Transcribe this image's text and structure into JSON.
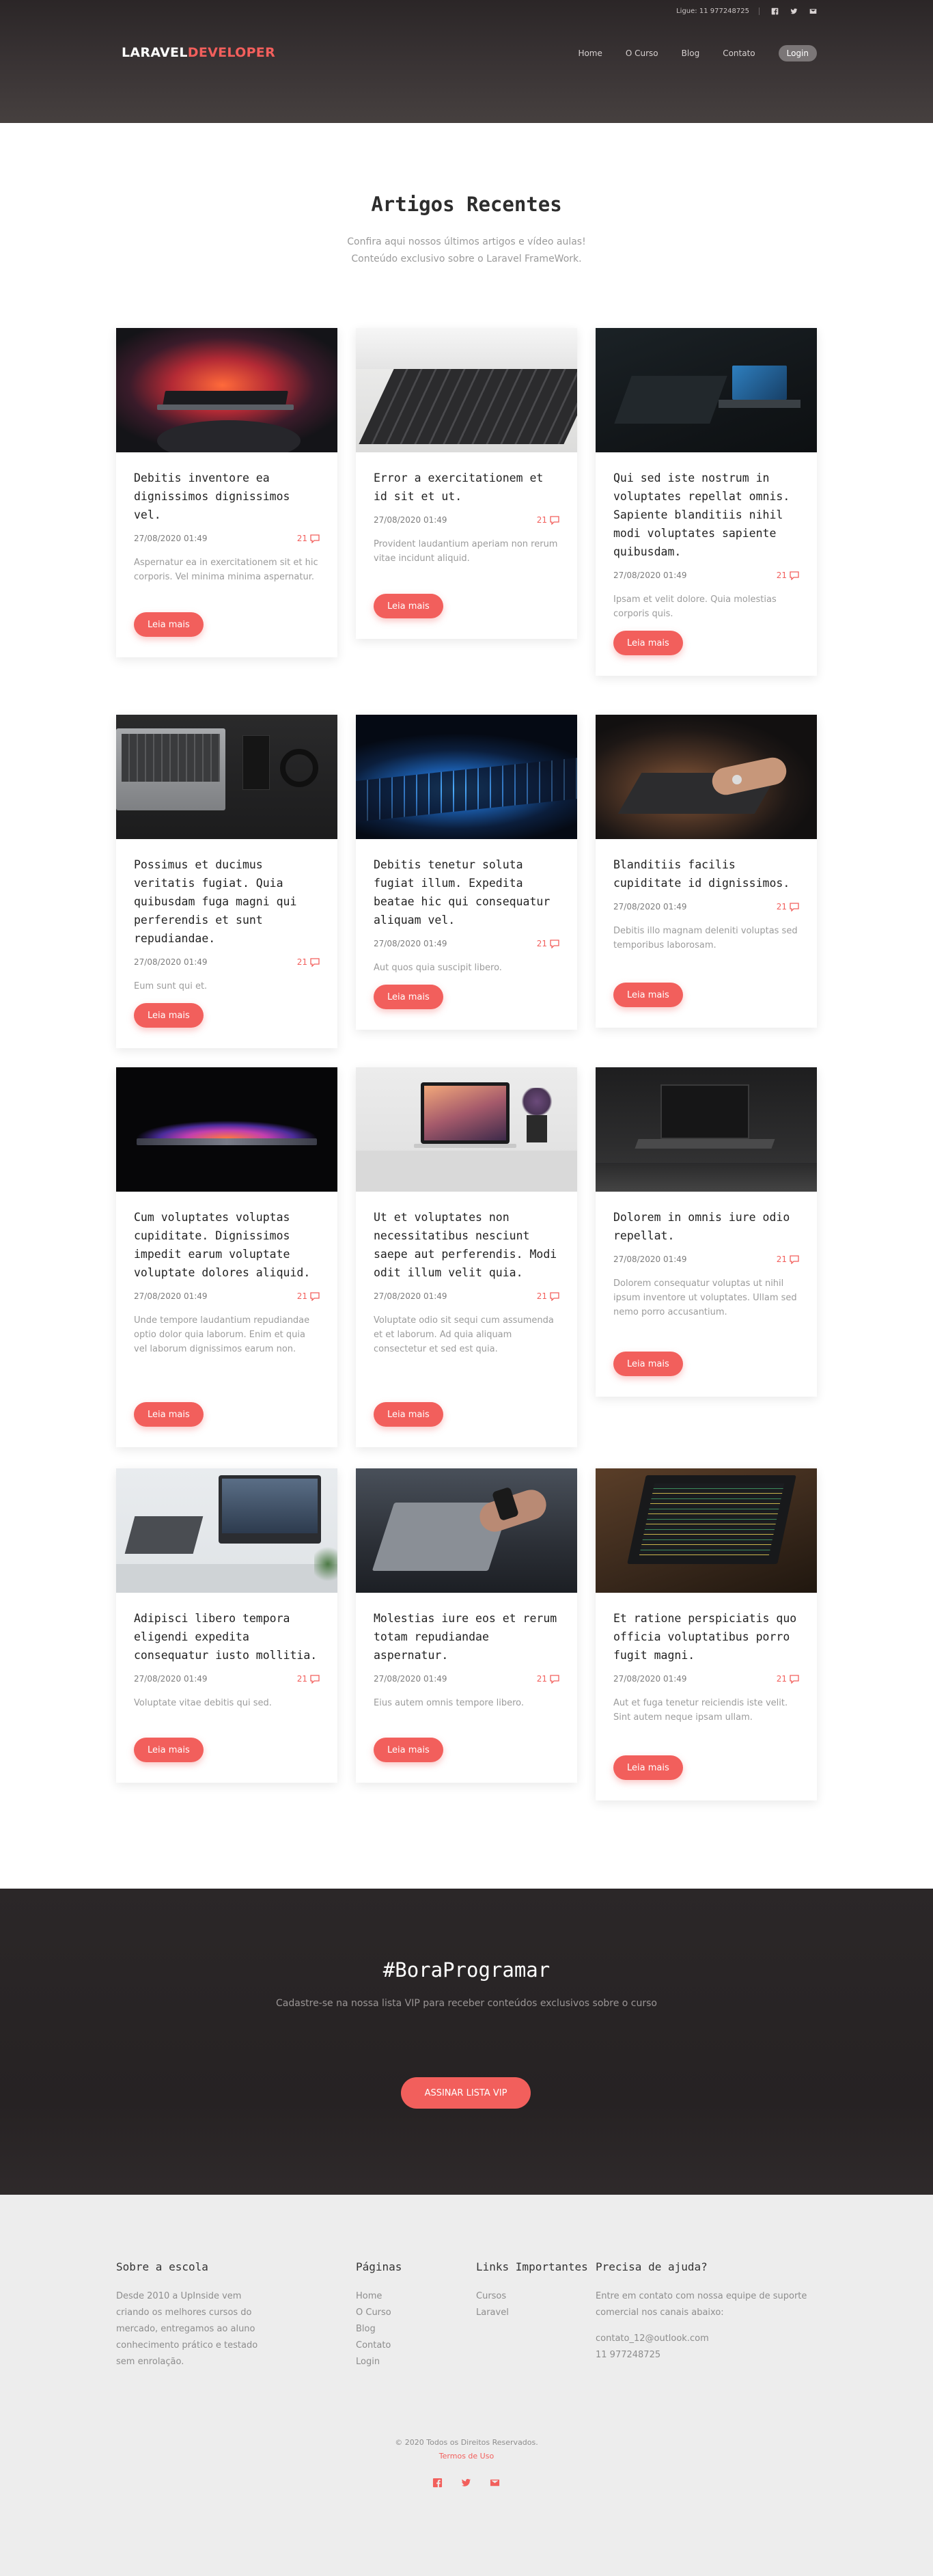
{
  "header": {
    "phone": "Ligue: 11 977248725",
    "brand_part1": "LARAVEL",
    "brand_part2": "DEVELOPER",
    "nav": [
      "Home",
      "O Curso",
      "Blog",
      "Contato",
      "Login"
    ]
  },
  "articles_section": {
    "title": "Artigos Recentes",
    "subtitle_line1": "Confira aqui nossos últimos artigos e vídeo aulas!",
    "subtitle_line2": "Conteúdo exclusivo sobre o Laravel FrameWork."
  },
  "cards": [
    {
      "image": "laptop-red-glow",
      "title": "Debitis inventore ea dignissimos dignissimos vel.",
      "date": "27/08/2020 01:49",
      "comments": "21",
      "excerpt": "Aspernatur ea in exercitationem sit et hic corporis. Vel minima minima aspernatur.",
      "button": "Leia mais"
    },
    {
      "image": "laptop-keyboard-closeup",
      "title": "Error a exercitationem et id sit et ut.",
      "date": "27/08/2020 01:49",
      "comments": "21",
      "excerpt": "Provident laudantium aperiam non rerum vitae incidunt aliquid.",
      "button": "Leia mais"
    },
    {
      "image": "dark-desk-laptop",
      "title": "Qui sed iste nostrum in voluptates repellat omnis. Sapiente blanditiis nihil modi voluptates sapiente quibusdam.",
      "date": "27/08/2020 01:49",
      "comments": "21",
      "excerpt": "Ipsam et velit dolore. Quia molestias corporis quis.",
      "button": "Leia mais"
    },
    {
      "image": "laptop-headphones-desk",
      "title": "Possimus et ducimus veritatis fugiat. Quia quibusdam fuga magni qui perferendis et sunt repudiandae.",
      "date": "27/08/2020 01:49",
      "comments": "21",
      "excerpt": "Eum sunt qui et.",
      "button": "Leia mais"
    },
    {
      "image": "blue-keyboard-glow",
      "title": "Debitis tenetur soluta fugiat illum. Expedita beatae hic qui consequatur aliquam vel.",
      "date": "27/08/2020 01:49",
      "comments": "21",
      "excerpt": "Aut quos quia suscipit libero.",
      "button": "Leia mais"
    },
    {
      "image": "hands-typing-laptop",
      "title": "Blanditiis facilis cupiditate id dignissimos.",
      "date": "27/08/2020 01:49",
      "comments": "21",
      "excerpt": "Debitis illo magnam deleniti voluptas sed temporibus laborosam.",
      "button": "Leia mais"
    },
    {
      "image": "laptop-colorful-glow",
      "title": "Cum voluptates voluptas cupiditate. Dignissimos impedit earum voluptate voluptate dolores aliquid.",
      "date": "27/08/2020 01:49",
      "comments": "21",
      "excerpt": "Unde tempore laudantium repudiandae optio dolor quia laborum. Enim et quia vel laborum dignissimos earum non.",
      "button": "Leia mais"
    },
    {
      "image": "macbook-on-desk-plant",
      "title": "Ut et voluptates non necessitatibus nesciunt saepe aut perferendis. Modi odit illum velit quia.",
      "date": "27/08/2020 01:49",
      "comments": "21",
      "excerpt": "Voluptate odio sit sequi cum assumenda et et laborum. Ad quia aliquam consectetur et sed est quia.",
      "button": "Leia mais"
    },
    {
      "image": "laptop-dark-street",
      "title": "Dolorem in omnis iure odio repellat.",
      "date": "27/08/2020 01:49",
      "comments": "21",
      "excerpt": "Dolorem consequatur voluptas ut nihil ipsum inventore ut voluptates. Ullam sed nemo porro accusantium.",
      "button": "Leia mais"
    },
    {
      "image": "imac-workspace",
      "title": "Adipisci libero tempora eligendi expedita consequatur iusto mollitia.",
      "date": "27/08/2020 01:49",
      "comments": "21",
      "excerpt": "Voluptate vitae debitis qui sed.",
      "button": "Leia mais"
    },
    {
      "image": "hand-on-laptop",
      "title": "Molestias iure eos et rerum totam repudiandae aspernatur.",
      "date": "27/08/2020 01:49",
      "comments": "21",
      "excerpt": "Eius autem omnis tempore libero.",
      "button": "Leia mais"
    },
    {
      "image": "laptop-code-wood",
      "title": "Et ratione perspiciatis quo officia voluptatibus porro fugit magni.",
      "date": "27/08/2020 01:49",
      "comments": "21",
      "excerpt": "Aut et fuga tenetur reiciendis iste velit. Sint autem neque ipsam ullam.",
      "button": "Leia mais"
    }
  ],
  "vip": {
    "title": "#BoraProgramar",
    "subtitle": "Cadastre-se na nossa lista VIP para receber conteúdos exclusivos sobre o curso",
    "button": "ASSINAR LISTA VIP"
  },
  "footer": {
    "about_title": "Sobre a escola",
    "about_lines": [
      "Desde 2010 a UpInside vem",
      "criando os melhores cursos do",
      "mercado, entregamos ao aluno",
      "conhecimento prático e testado",
      "sem enrolação."
    ],
    "pages_title": "Páginas",
    "pages": [
      "Home",
      "O Curso",
      "Blog",
      "Contato",
      "Login"
    ],
    "links_title": "Links Importantes",
    "links": [
      "Cursos",
      "Laravel"
    ],
    "help_title": "Precisa de ajuda?",
    "help_lines": [
      "Entre em contato com nossa equipe de suporte",
      "comercial nos canais abaixo:"
    ],
    "email": "contato_12@outlook.com",
    "phone": "11 977248725",
    "copyright": "© 2020 Todos os Direitos Reservados.",
    "terms": "Termos de Uso"
  },
  "colors": {
    "accent": "#f25f5c",
    "header_bg": "#3a3435",
    "footer_bg": "#ededed"
  },
  "social_icons": [
    "facebook-icon",
    "twitter-icon",
    "email-icon"
  ]
}
